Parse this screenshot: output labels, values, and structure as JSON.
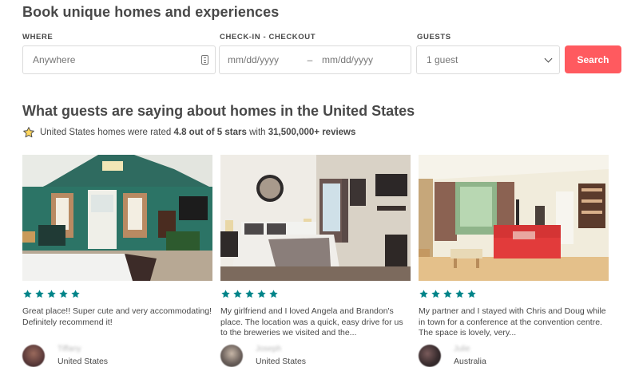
{
  "header": {
    "title": "Book unique homes and experiences"
  },
  "search": {
    "where_label": "WHERE",
    "where_placeholder": "Anywhere",
    "dates_label": "CHECK-IN - CHECKOUT",
    "checkin_placeholder": "mm/dd/yyyy",
    "date_separator": "–",
    "checkout_placeholder": "mm/dd/yyyy",
    "guests_label": "GUESTS",
    "guests_value": "1 guest",
    "search_button": "Search"
  },
  "reviews_section": {
    "title": "What guests are saying about homes in the United States",
    "rating_prefix": "United States homes were rated",
    "rating_value": "4.8 out of 5 stars",
    "rating_middle": "with",
    "review_count": "31,500,000+ reviews"
  },
  "cards": [
    {
      "stars": 5,
      "review": "Great place!! Super cute and very accommodating! Definitely recommend it!",
      "name": "Tiffany",
      "location": "United States"
    },
    {
      "stars": 5,
      "review": "My girlfriend and I loved Angela and Brandon's place. The location was a quick, easy drive for us to the breweries we visited and the...",
      "name": "Joseph",
      "location": "United States"
    },
    {
      "stars": 5,
      "review": "My partner and I stayed with Chris and Doug while in town for a conference at the convention centre. The space is lovely, very...",
      "name": "Julie",
      "location": "Australia"
    }
  ],
  "colors": {
    "accent": "#ff5a5f",
    "star": "#008489",
    "text": "#484848"
  }
}
